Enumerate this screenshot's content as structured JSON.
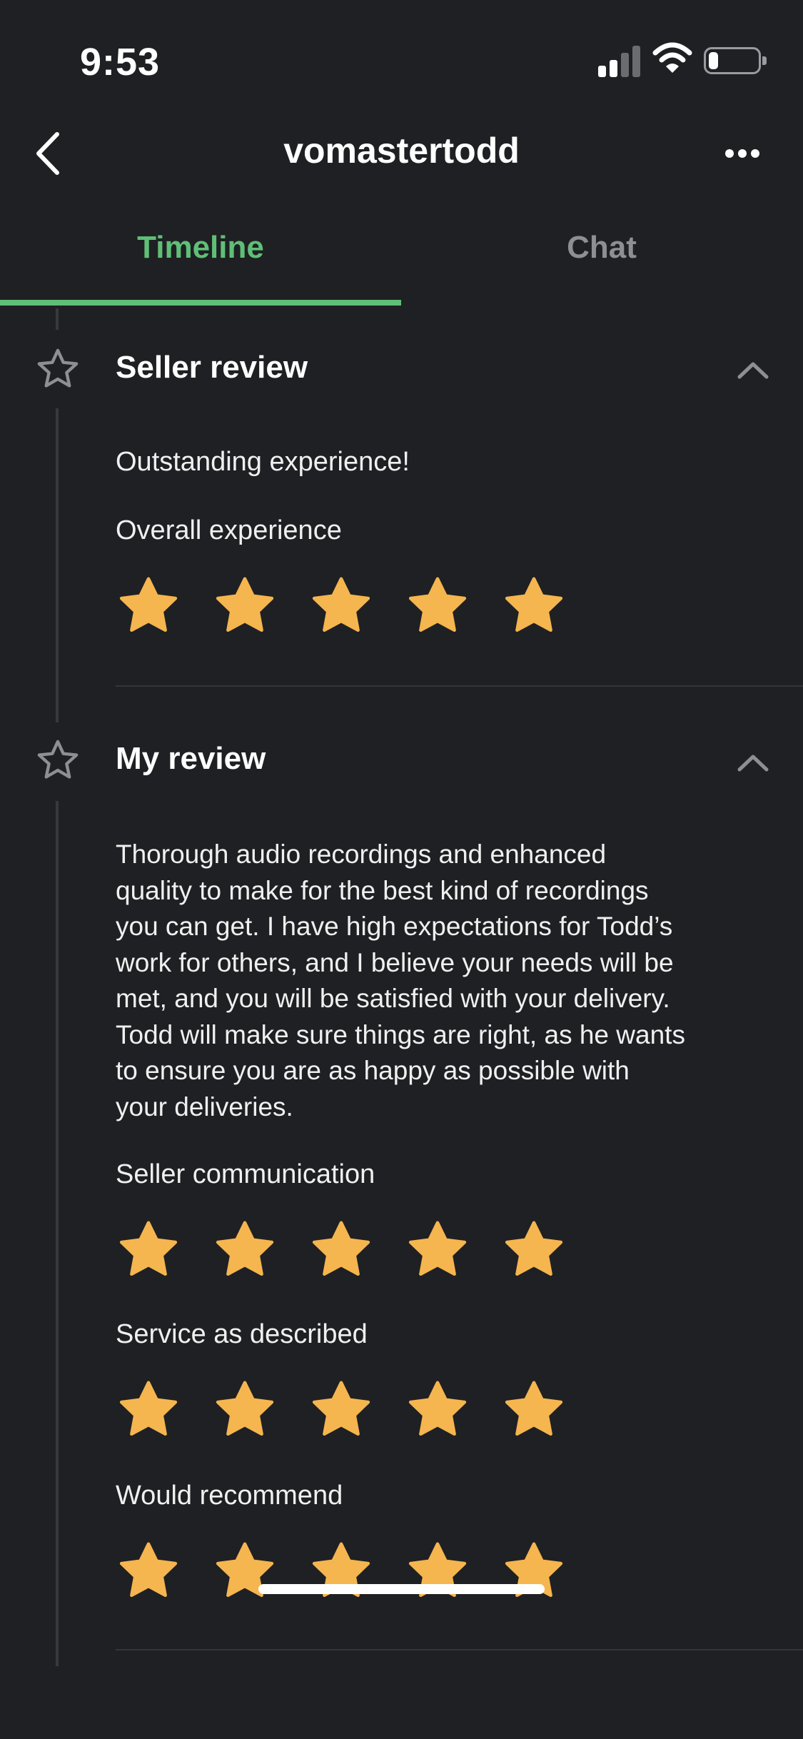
{
  "status_bar": {
    "time": "9:53",
    "battery_level": 0.2,
    "icons": [
      "cellular-signal-icon",
      "wifi-icon",
      "battery-icon"
    ]
  },
  "header": {
    "title": "vomastertodd",
    "back_icon": "chevron-left-icon",
    "more_icon": "ellipsis-icon"
  },
  "tabs": [
    {
      "label": "Timeline",
      "active": true
    },
    {
      "label": "Chat",
      "active": false
    }
  ],
  "colors": {
    "background": "#1f2023",
    "accent_green": "#5fbf77",
    "star_gold": "#f5b54f",
    "muted": "#8e8f93"
  },
  "seller_review": {
    "title": "Seller review",
    "comment": "Outstanding experience!",
    "ratings": [
      {
        "label": "Overall experience",
        "stars": 5,
        "max": 5
      }
    ]
  },
  "my_review": {
    "title": "My review",
    "comment_lines": [
      "Thorough audio recordings and enhanced",
      "quality to make for the best kind of recordings",
      "you can get. I have high expectations for Todd’s",
      "work for others, and I believe your needs will be",
      "met, and you will be satisfied with your delivery.",
      "Todd will make sure things are right, as he wants",
      "to ensure you are as happy as possible with",
      "your deliveries."
    ],
    "ratings": [
      {
        "label": "Seller communication",
        "stars": 5,
        "max": 5
      },
      {
        "label": "Service as described",
        "stars": 5,
        "max": 5
      },
      {
        "label": "Would recommend",
        "stars": 5,
        "max": 5
      }
    ]
  }
}
